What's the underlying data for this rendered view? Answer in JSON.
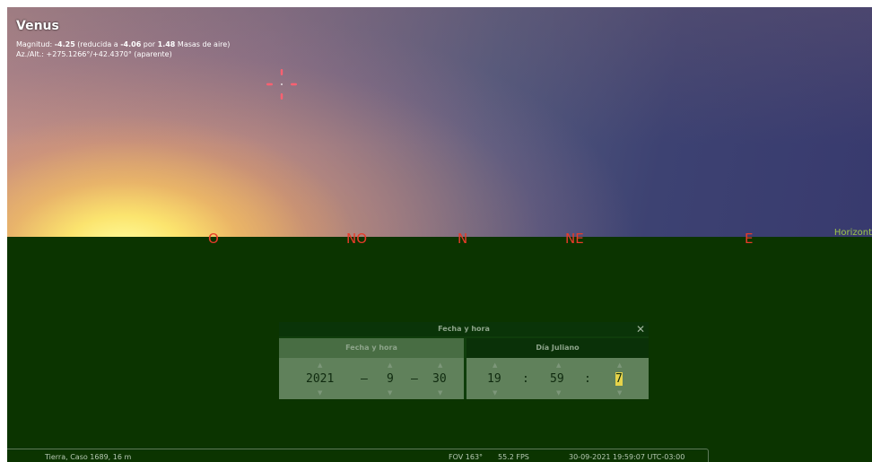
{
  "object": {
    "name": "Venus",
    "mag_label": "Magnitud: ",
    "mag_value": "-4.25",
    "mag_mid1": " (reducida a ",
    "mag_reduced": "-4.06",
    "mag_mid2": " por ",
    "air_masses": "1.48",
    "mag_end": " Masas de aire)",
    "azalt": "Az./Alt.: +275.1266°/+42.4370° (aparente)"
  },
  "cardinals": [
    "O",
    "NO",
    "N",
    "NE",
    "E"
  ],
  "horizon_label": "Horizont",
  "dialog": {
    "title": "Fecha y hora",
    "close_glyph": "✕",
    "tab_fecha": "Fecha y hora",
    "tab_juliano": "Día Juliano",
    "year": "2021",
    "month": "9",
    "day": "30",
    "hour": "19",
    "minute": "59",
    "second": "7",
    "date_sep": "–",
    "time_sep": ":",
    "arrow_up": "▲",
    "arrow_down": "▼"
  },
  "status_bar": {
    "location": "Tierra, Caso 1689, 16 m",
    "fov": "FOV 163°",
    "fps": "55.2 FPS",
    "datetime": "30-09-2021 19:59:07 UTC-03:00"
  },
  "colors": {
    "cardinal": "#e83b2a",
    "ground": "#0b3400",
    "reticle": "#ff6070",
    "horizon_label": "#9ec64a",
    "seconds_highlight": "#e6d34a"
  }
}
